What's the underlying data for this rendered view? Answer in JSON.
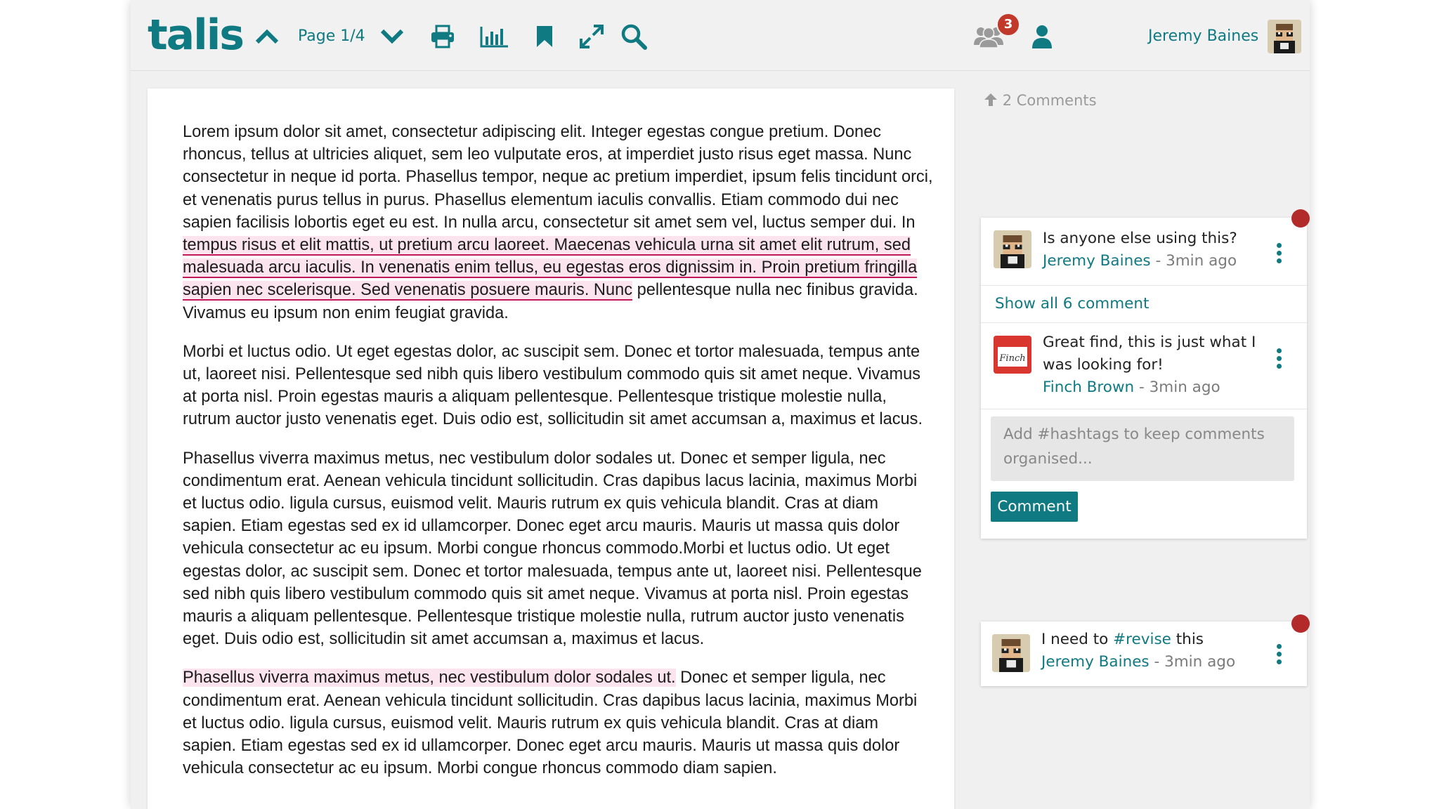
{
  "header": {
    "logo": "talis",
    "page_label": "Page 1/4",
    "notification_count": "3",
    "user_name": "Jeremy Baines"
  },
  "document": {
    "paragraphs": [
      {
        "pre": "Lorem ipsum dolor sit amet, consectetur adipiscing elit. Integer egestas congue pretium. Donec rhoncus, tellus at ultricies aliquet, sem leo vulputate eros, at imperdiet justo risus eget massa. Nunc consectetur in neque id porta. Phasellus tempor, neque ac pretium imperdiet, ipsum felis tincidunt orci, et venenatis purus tellus in purus. Phasellus elementum iaculis convallis. Etiam commodo dui nec sapien facilisis lobortis eget eu est. In nulla arcu, consectetur sit amet sem vel, luctus semper dui. In ",
        "highlight": "tempus risus et elit mattis, ut pretium arcu laoreet. Maecenas vehicula urna sit amet elit rutrum, sed malesuada arcu iaculis. In venenatis enim tellus, eu egestas eros dignissim in. Proin pretium fringilla sapien nec scelerisque. Sed venenatis posuere mauris. Nunc",
        "post": " pellentesque nulla nec finibus gravida. Vivamus eu ipsum non enim feugiat gravida."
      },
      {
        "text": "Morbi et luctus odio. Ut eget egestas dolor, ac suscipit sem. Donec et tortor malesuada, tempus ante ut, laoreet nisi. Pellentesque sed nibh quis libero vestibulum commodo quis sit amet neque. Vivamus at porta nisl. Proin egestas mauris a aliquam pellentesque. Pellentesque tristique molestie nulla, rutrum auctor justo venenatis eget. Duis odio est, sollicitudin sit amet accumsan a, maximus et lacus."
      },
      {
        "text": "Phasellus viverra maximus metus, nec vestibulum dolor sodales ut. Donec et semper ligula, nec condimentum erat. Aenean vehicula tincidunt sollicitudin. Cras dapibus lacus lacinia, maximus Morbi et luctus odio. ligula cursus, euismod velit. Mauris rutrum ex quis vehicula blandit. Cras at diam sapien. Etiam egestas sed ex id ullamcorper. Donec eget arcu mauris. Mauris ut massa quis dolor vehicula consectetur ac eu ipsum. Morbi congue rhoncus commodo.Morbi et luctus odio. Ut eget egestas dolor, ac suscipit sem. Donec et tortor malesuada, tempus ante ut, laoreet nisi. Pellentesque sed nibh quis libero vestibulum commodo quis sit amet neque. Vivamus at porta nisl. Proin egestas mauris a aliquam pellentesque. Pellentesque tristique molestie nulla, rutrum auctor justo venenatis eget. Duis odio est, sollicitudin sit amet accumsan a, maximus et lacus."
      },
      {
        "highlight": "Phasellus viverra maximus metus, nec vestibulum dolor sodales ut.",
        "post": " Donec et semper ligula, nec condimentum erat. Aenean vehicula tincidunt sollicitudin. Cras dapibus lacus lacinia, maximus Morbi et luctus odio. ligula cursus, euismod velit. Mauris rutrum ex quis vehicula blandit. Cras at diam sapien. Etiam egestas sed ex id ullamcorper. Donec eget arcu mauris. Mauris ut massa quis dolor vehicula consectetur ac eu ipsum. Morbi congue rhoncus commodo diam sapien."
      }
    ]
  },
  "comments": {
    "count_label": "2 Comments",
    "thread1": {
      "first": {
        "text": "Is anyone else using this?",
        "author": "Jeremy Baines",
        "sep": " - ",
        "time": "3min ago"
      },
      "show_all_label": "Show all 6 comment",
      "reply": {
        "text": "Great find, this is just what I was looking for!",
        "author": "Finch Brown",
        "sep": " - ",
        "time": "3min ago",
        "avatar_label": "Finch"
      },
      "input_placeholder": "Add #hashtags to keep comments organised...",
      "button_label": "Comment"
    },
    "thread2": {
      "text_pre": "I need to ",
      "hashtag": "#revise",
      "text_post": " this",
      "author": "Jeremy Baines",
      "sep": " - ",
      "time": " 3min ago"
    }
  },
  "colors": {
    "accent": "#0f7a82",
    "highlight_bg": "#fbe4ee",
    "highlight_line": "#c2185b",
    "badge": "#c0392b",
    "marker": "#b22a2a"
  },
  "icons": [
    "chevron-up-icon",
    "chevron-down-icon",
    "print-icon",
    "chart-icon",
    "bookmark-icon",
    "expand-icon",
    "search-icon",
    "group-icon",
    "user-icon",
    "kebab-icon",
    "arrow-up-icon"
  ]
}
